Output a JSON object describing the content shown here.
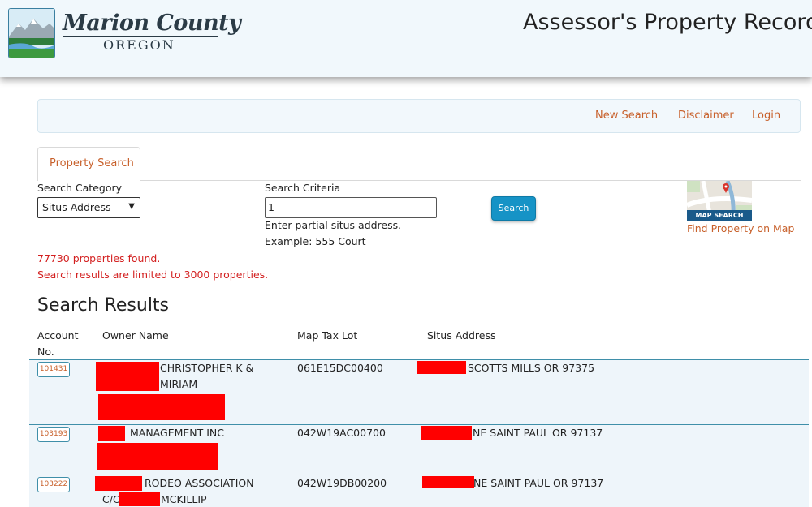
{
  "header": {
    "logo": {
      "name": "Marion County",
      "state": "OREGON"
    },
    "title": "Assessor's Property Record"
  },
  "nav": {
    "new_search": "New Search",
    "disclaimer": "Disclaimer",
    "login": "Login"
  },
  "tabs": [
    {
      "label": "Property Search"
    }
  ],
  "search": {
    "category_label": "Search Category",
    "category_value": "Situs Address",
    "criteria_label": "Search Criteria",
    "criteria_value": "1",
    "help_line1": "Enter partial situs address.",
    "help_line2": "Example: 555 Court",
    "button": "Search"
  },
  "map": {
    "badge": "MAP SEARCH",
    "link": "Find Property on Map"
  },
  "messages": {
    "found": "77730 properties found.",
    "limit": "Search results are limited to 3000 properties."
  },
  "results": {
    "title": "Search Results",
    "headers": {
      "account": "Account No.",
      "owner": "Owner Name",
      "maptaxlot": "Map Tax Lot",
      "situs": "Situs Address"
    },
    "rows": [
      {
        "account": "101431",
        "owner_line1": "CHRISTOPHER K &",
        "owner_line2": "MIRIAM",
        "maptaxlot": "061E15DC00400",
        "situs": "SCOTTS MILLS OR 97375"
      },
      {
        "account": "103193",
        "owner_line1": "MANAGEMENT INC",
        "owner_line2": "",
        "maptaxlot": "042W19AC00700",
        "situs": "NE SAINT PAUL OR 97137"
      },
      {
        "account": "103222",
        "owner_line1": "RODEO ASSOCIATION",
        "owner_line2_prefix": "C/O",
        "owner_line2": "MCKILLIP",
        "maptaxlot": "042W19DB00200",
        "situs": "NE SAINT PAUL OR 97137"
      }
    ]
  },
  "colors": {
    "accent": "#c8612c",
    "button": "#1693c6",
    "error": "#d32020",
    "redaction": "#ff0000",
    "row_border": "#3f8fa9"
  }
}
